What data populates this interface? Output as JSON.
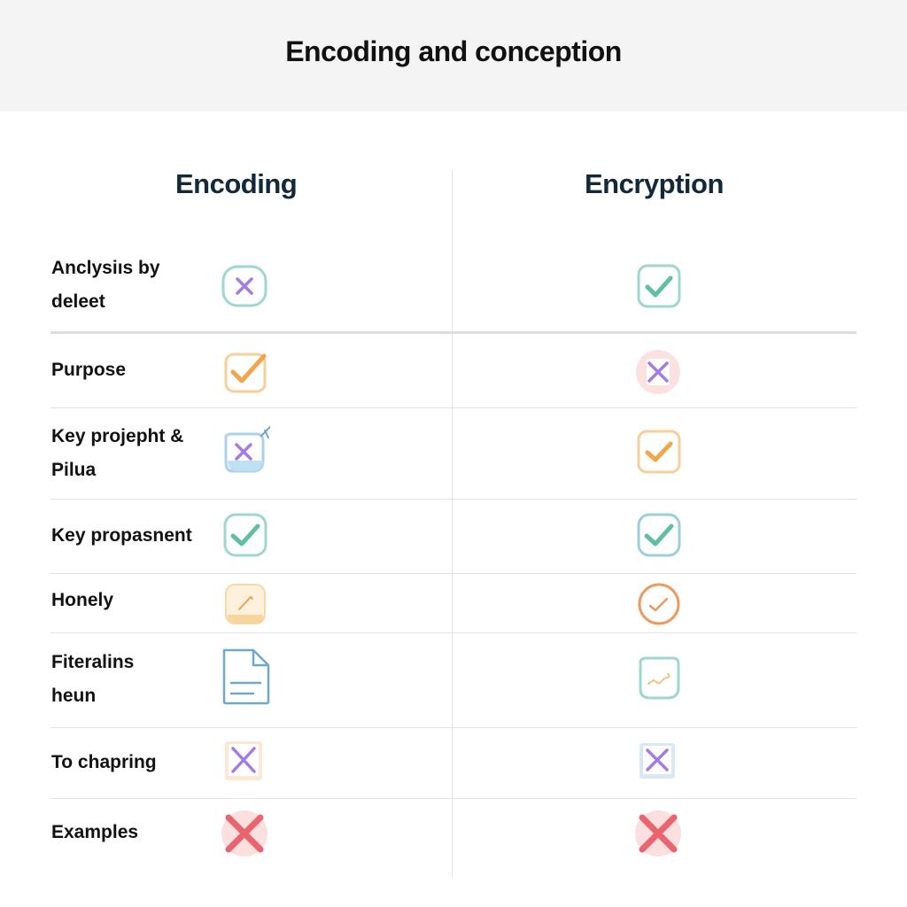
{
  "title": "Encoding and conception",
  "columns": [
    "Encoding",
    "Encryption"
  ],
  "rows": [
    {
      "label": "Anclysiıs by\ndeleet",
      "encoding": {
        "icon": "x-mark-icon",
        "value": "no"
      },
      "encryption": {
        "icon": "check-mark-icon",
        "value": "yes"
      }
    },
    {
      "label": "Purpose",
      "encoding": {
        "icon": "check-mark-icon",
        "value": "yes"
      },
      "encryption": {
        "icon": "x-mark-icon",
        "value": "no"
      }
    },
    {
      "label": "Key projepht &\nPilua",
      "encoding": {
        "icon": "x-mark-icon",
        "value": "no"
      },
      "encryption": {
        "icon": "check-mark-icon",
        "value": "yes"
      }
    },
    {
      "label": "Key propasnent",
      "encoding": {
        "icon": "check-mark-icon",
        "value": "yes"
      },
      "encryption": {
        "icon": "check-mark-icon",
        "value": "yes"
      }
    },
    {
      "label": "Honely",
      "encoding": {
        "icon": "pencil-icon",
        "value": "partial"
      },
      "encryption": {
        "icon": "circle-check-icon",
        "value": "yes"
      }
    },
    {
      "label": "Fiteralins\nheun",
      "encoding": {
        "icon": "document-icon",
        "value": "document"
      },
      "encryption": {
        "icon": "scribble-icon",
        "value": "partial"
      }
    },
    {
      "label": "To chapring",
      "encoding": {
        "icon": "x-mark-icon",
        "value": "no"
      },
      "encryption": {
        "icon": "x-mark-icon",
        "value": "no"
      }
    },
    {
      "label": "Examples",
      "encoding": {
        "icon": "red-x-icon",
        "value": "no"
      },
      "encryption": {
        "icon": "red-x-icon",
        "value": "no"
      }
    }
  ],
  "colors": {
    "teal": "#5fbf9f",
    "orange": "#f2a54a",
    "purple": "#a27be6",
    "red": "#e9646d",
    "blue": "#6fa8c9"
  }
}
